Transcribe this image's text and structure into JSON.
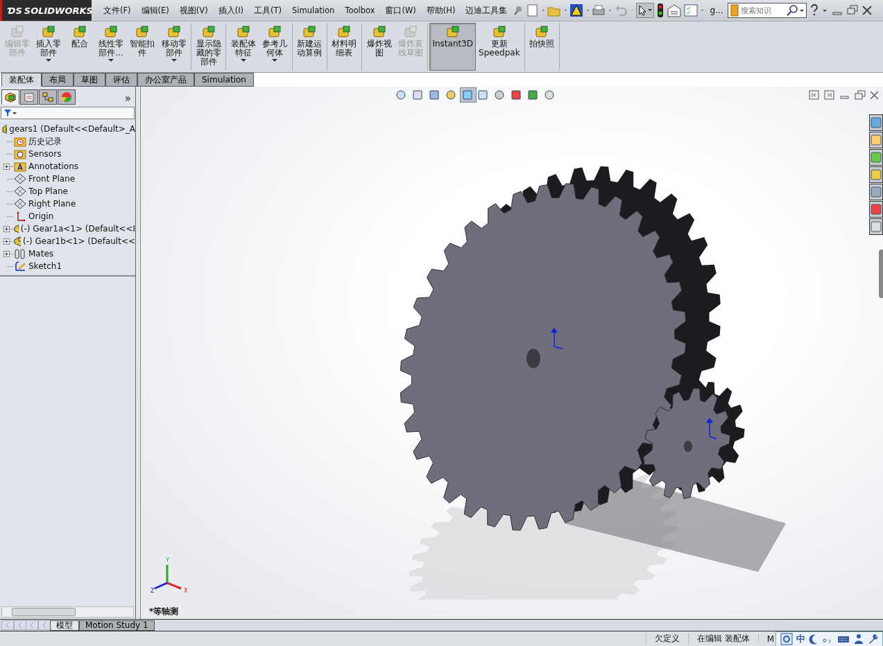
{
  "title_bar": {
    "logo_mark": "ƊS",
    "logo": "SOLIDWORKS",
    "menu": [
      {
        "label": "文件(F)"
      },
      {
        "label": "编辑(E)"
      },
      {
        "label": "视图(V)"
      },
      {
        "label": "插入(I)"
      },
      {
        "label": "工具(T)"
      },
      {
        "label": "Simulation"
      },
      {
        "label": "Toolbox"
      },
      {
        "label": "窗口(W)"
      },
      {
        "label": "帮助(H)"
      },
      {
        "label": "迈迪工具集"
      }
    ],
    "document_name": "g...",
    "search": {
      "placeholder": "搜索知识"
    }
  },
  "ribbon": {
    "groups": [
      {
        "buttons": [
          {
            "label": "编辑零部件",
            "disabled": true,
            "dropdown": false,
            "selected": false
          },
          {
            "label": "插入零部件",
            "disabled": false,
            "dropdown": true,
            "selected": false
          },
          {
            "label": "配合",
            "disabled": false,
            "dropdown": false,
            "selected": false
          },
          {
            "label": "线性零部件...",
            "disabled": false,
            "dropdown": true,
            "selected": false
          },
          {
            "label": "智能扣件",
            "disabled": false,
            "dropdown": false,
            "selected": false
          },
          {
            "label": "移动零部件",
            "disabled": false,
            "dropdown": true,
            "selected": false
          }
        ]
      },
      {
        "buttons": [
          {
            "label": "显示隐藏的零部件",
            "disabled": false,
            "dropdown": false,
            "selected": false
          }
        ]
      },
      {
        "buttons": [
          {
            "label": "装配体特征",
            "disabled": false,
            "dropdown": true,
            "selected": false
          },
          {
            "label": "参考几何体",
            "disabled": false,
            "dropdown": true,
            "selected": false
          }
        ]
      },
      {
        "buttons": [
          {
            "label": "新建运动算例",
            "disabled": false,
            "dropdown": false,
            "selected": false
          }
        ]
      },
      {
        "buttons": [
          {
            "label": "材料明细表",
            "disabled": false,
            "dropdown": false,
            "selected": false
          }
        ]
      },
      {
        "buttons": [
          {
            "label": "爆炸视图",
            "disabled": false,
            "dropdown": false,
            "selected": false
          },
          {
            "label": "爆炸直线草图",
            "disabled": true,
            "dropdown": false,
            "selected": false
          }
        ]
      },
      {
        "buttons": [
          {
            "label": "Instant3D",
            "disabled": false,
            "dropdown": false,
            "selected": true
          },
          {
            "label": "更新Speedpak",
            "disabled": false,
            "dropdown": false,
            "selected": false
          }
        ]
      },
      {
        "buttons": [
          {
            "label": "拍快照",
            "disabled": false,
            "dropdown": false,
            "selected": false
          }
        ]
      }
    ]
  },
  "command_tabs": [
    {
      "label": "装配体",
      "selected": true
    },
    {
      "label": "布局",
      "selected": false
    },
    {
      "label": "草图",
      "selected": false
    },
    {
      "label": "评估",
      "selected": false
    },
    {
      "label": "办公室产品",
      "selected": false
    },
    {
      "label": "Simulation",
      "selected": false
    }
  ],
  "manager_tabs": [
    {
      "selected": true
    },
    {
      "selected": false
    },
    {
      "selected": false
    },
    {
      "selected": false
    }
  ],
  "manager_expand": "»",
  "feature_tree": {
    "root": {
      "label": "gears1  (Default<<Default>_A",
      "children": [
        {
          "kind": "history",
          "label": "历史记录",
          "expandable": false
        },
        {
          "kind": "sensor",
          "label": "Sensors",
          "expandable": false
        },
        {
          "kind": "annotation",
          "label": "Annotations",
          "expandable": true
        },
        {
          "kind": "plane",
          "label": "Front Plane",
          "expandable": false
        },
        {
          "kind": "plane",
          "label": "Top Plane",
          "expandable": false
        },
        {
          "kind": "plane",
          "label": "Right Plane",
          "expandable": false
        },
        {
          "kind": "origin",
          "label": "Origin",
          "expandable": false
        },
        {
          "kind": "part",
          "label": "(-) Gear1a<1> (Default<<I",
          "expandable": true
        },
        {
          "kind": "part",
          "label": "(-) Gear1b<1> (Default<<",
          "expandable": true
        },
        {
          "kind": "mates",
          "label": "Mates",
          "expandable": true
        },
        {
          "kind": "sketch",
          "label": "Sketch1",
          "expandable": false
        }
      ]
    }
  },
  "viewport": {
    "view_name": "*等轴测",
    "triad": [
      "Y",
      "X",
      "Z"
    ]
  },
  "bottom_tabs": [
    {
      "label": "模型",
      "selected": true
    },
    {
      "label": "Motion Study 1",
      "selected": false
    }
  ],
  "status_bar": {
    "fields": [
      "欠定义",
      "在编辑 装配体",
      "M"
    ]
  },
  "ime_bar": {
    "mode": "中"
  }
}
